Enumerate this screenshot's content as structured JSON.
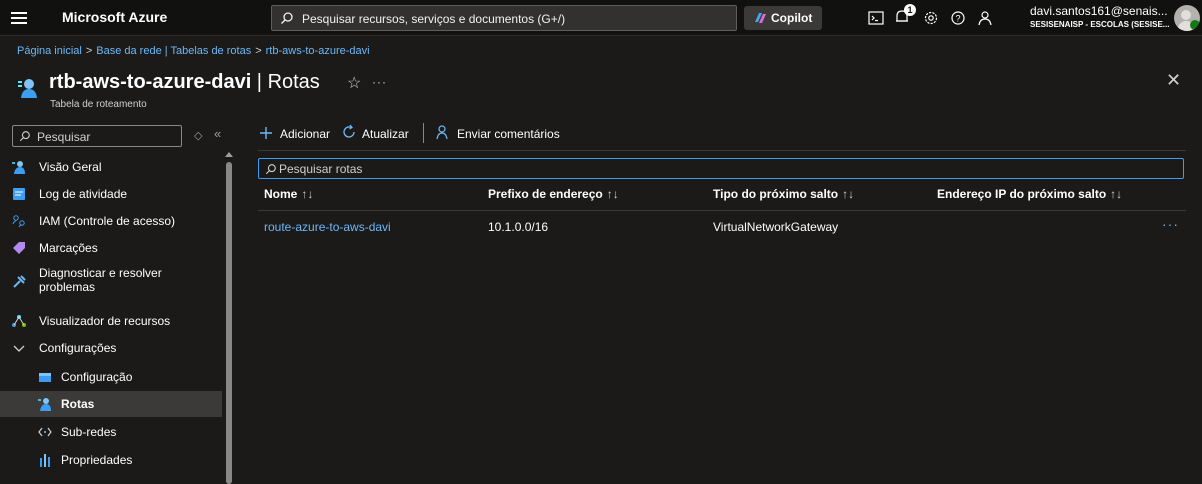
{
  "topbar": {
    "brand": "Microsoft Azure",
    "search_placeholder": "Pesquisar recursos, serviços e documentos (G+/)",
    "copilot_label": "Copilot",
    "notification_count": "1",
    "user_name": "davi.santos161@senais...",
    "user_org": "SESISENAISP - ESCOLAS (SESISE..."
  },
  "breadcrumb": {
    "items": [
      "Página inicial",
      "Base da rede | Tabelas de rotas",
      "rtb-aws-to-azure-davi"
    ]
  },
  "header": {
    "resource_name": "rtb-aws-to-azure-davi",
    "separator": " | ",
    "page_name": "Rotas",
    "subtitle": "Tabela de roteamento",
    "star": "☆",
    "more": "···",
    "close": "✕"
  },
  "sidebar": {
    "search_placeholder": "Pesquisar",
    "items": [
      {
        "label": "Visão Geral",
        "icon": "overview-icon"
      },
      {
        "label": "Log de atividade",
        "icon": "activity-log-icon"
      },
      {
        "label": "IAM (Controle de acesso)",
        "icon": "iam-icon"
      },
      {
        "label": "Marcações",
        "icon": "tag-icon"
      },
      {
        "label": "Diagnosticar e resolver",
        "label2": "problemas",
        "icon": "wrench-icon"
      },
      {
        "label": "Visualizador de recursos",
        "icon": "resource-visualizer-icon"
      },
      {
        "label": "Configurações",
        "icon": "chevron-down-icon"
      },
      {
        "label": "Configuração",
        "icon": "configuration-icon"
      },
      {
        "label": "Rotas",
        "icon": "routes-icon"
      },
      {
        "label": "Sub-redes",
        "icon": "subnets-icon"
      },
      {
        "label": "Propriedades",
        "icon": "properties-icon"
      }
    ]
  },
  "toolbar": {
    "add_label": "Adicionar",
    "refresh_label": "Atualizar",
    "feedback_label": "Enviar comentários"
  },
  "routes": {
    "search_placeholder": "Pesquisar rotas",
    "columns": [
      "Nome",
      "Prefixo de endereço",
      "Tipo do próximo salto",
      "Endereço IP do próximo salto"
    ],
    "sort_glyph": "↑↓",
    "rows": [
      {
        "name": "route-azure-to-aws-davi",
        "prefix": "10.1.0.0/16",
        "next_hop_type": "VirtualNetworkGateway",
        "next_hop_ip": ""
      }
    ],
    "row_more": "···"
  },
  "colors": {
    "background": "#1b1a19",
    "topbar": "#111110",
    "link": "#6cb8f6",
    "focus_border": "#3b9ef3",
    "active_item": "#3b3a39"
  }
}
